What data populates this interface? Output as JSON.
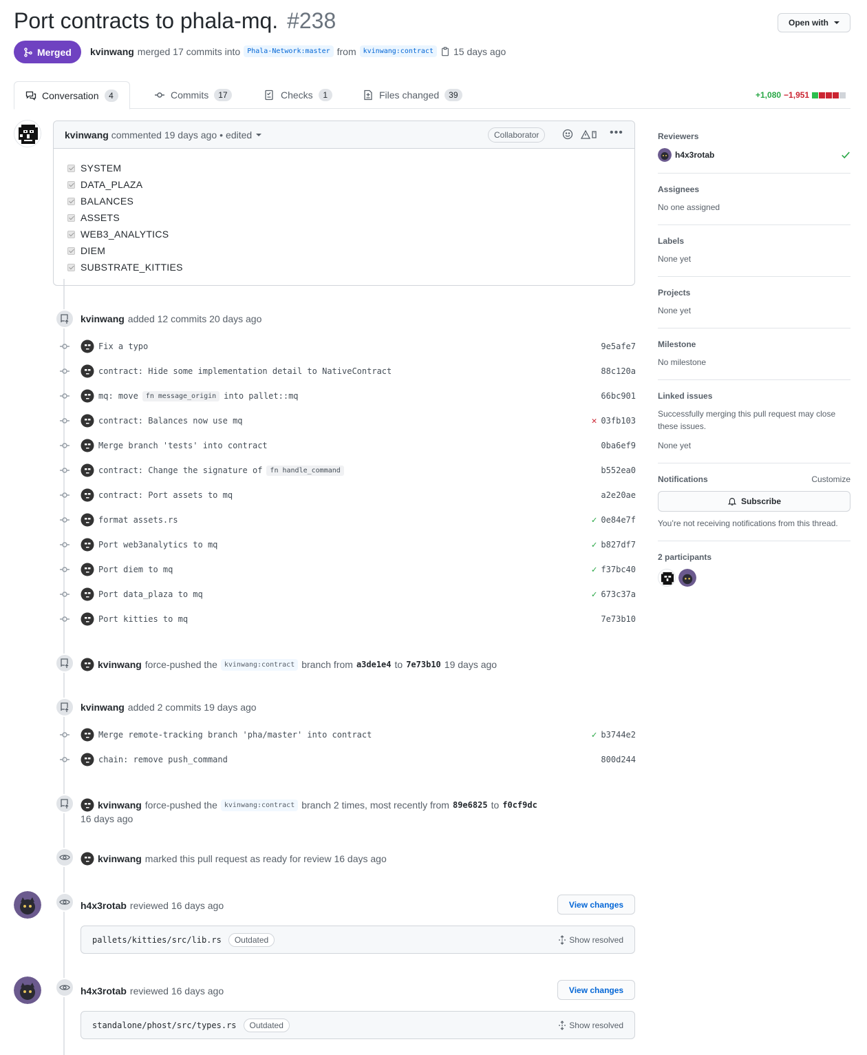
{
  "pr": {
    "title": "Port contracts to phala-mq.",
    "number": "#238",
    "status": "Merged",
    "author": "kvinwang",
    "merged_text": "merged 17 commits into",
    "base_branch": "Phala-Network:master",
    "from_text": "from",
    "head_branch": "kvinwang:contract",
    "time": "15 days ago",
    "open_with": "Open with"
  },
  "tabs": [
    {
      "label": "Conversation",
      "count": "4"
    },
    {
      "label": "Commits",
      "count": "17"
    },
    {
      "label": "Checks",
      "count": "1"
    },
    {
      "label": "Files changed",
      "count": "39"
    }
  ],
  "diffstat": {
    "additions": "+1,080",
    "deletions": "−1,951"
  },
  "comment": {
    "author": "kvinwang",
    "meta": "commented 19 days ago",
    "edited": "edited",
    "role": "Collaborator",
    "items": [
      "SYSTEM",
      "DATA_PLAZA",
      "BALANCES",
      "ASSETS",
      "WEB3_ANALYTICS",
      "DIEM",
      "SUBSTRATE_KITTIES"
    ]
  },
  "event1": {
    "author": "kvinwang",
    "text": "added 12 commits 20 days ago"
  },
  "commits1": [
    {
      "msg": "Fix a typo",
      "sha": "9e5afe7",
      "status": ""
    },
    {
      "msg": "contract: Hide some implementation detail to NativeContract",
      "sha": "88c120a",
      "status": ""
    },
    {
      "msg_pre": "mq: move",
      "code": "fn message_origin",
      "msg_post": "into pallet::mq",
      "sha": "66bc901",
      "status": ""
    },
    {
      "msg": "contract: Balances now use mq",
      "sha": "03fb103",
      "status": "fail"
    },
    {
      "msg": "Merge branch 'tests' into contract",
      "sha": "0ba6ef9",
      "status": ""
    },
    {
      "msg_pre": "contract: Change the signature of",
      "code": "fn handle_command",
      "msg_post": "",
      "sha": "b552ea0",
      "status": ""
    },
    {
      "msg": "contract: Port assets to mq",
      "sha": "a2e20ae",
      "status": ""
    },
    {
      "msg": "format assets.rs",
      "sha": "0e84e7f",
      "status": "ok"
    },
    {
      "msg": "Port web3analytics to mq",
      "sha": "b827df7",
      "status": "ok"
    },
    {
      "msg": "Port diem to mq",
      "sha": "f37bc40",
      "status": "ok"
    },
    {
      "msg": "Port data_plaza to mq",
      "sha": "673c37a",
      "status": "ok"
    },
    {
      "msg": "Port kitties to mq",
      "sha": "7e73b10",
      "status": ""
    }
  ],
  "event2": {
    "author": "kvinwang",
    "pre": "force-pushed the",
    "branch": "kvinwang:contract",
    "mid": "branch from",
    "from": "a3de1e4",
    "to_word": "to",
    "to": "7e73b10",
    "time": "19 days ago"
  },
  "event3": {
    "author": "kvinwang",
    "text": "added 2 commits 19 days ago"
  },
  "commits2": [
    {
      "msg": "Merge remote-tracking branch 'pha/master' into contract",
      "sha": "b3744e2",
      "status": "ok"
    },
    {
      "msg": "chain: remove push_command",
      "sha": "800d244",
      "status": ""
    }
  ],
  "event4": {
    "author": "kvinwang",
    "pre": "force-pushed the",
    "branch": "kvinwang:contract",
    "mid": "branch 2 times, most recently from",
    "from": "89e6825",
    "to_word": "to",
    "to": "f0cf9dc",
    "time": "16 days ago"
  },
  "event5": {
    "author": "kvinwang",
    "text": "marked this pull request as ready for review 16 days ago"
  },
  "reviews": [
    {
      "author": "h4x3rotab",
      "text": "reviewed 16 days ago",
      "button": "View changes",
      "file": "pallets/kitties/src/lib.rs",
      "tag": "Outdated",
      "action": "Show resolved"
    },
    {
      "author": "h4x3rotab",
      "text": "reviewed 16 days ago",
      "button": "View changes",
      "file": "standalone/phost/src/types.rs",
      "tag": "Outdated",
      "action": "Show resolved"
    }
  ],
  "sidebar": {
    "reviewers_h": "Reviewers",
    "reviewer": "h4x3rotab",
    "assignees_h": "Assignees",
    "assignees_v": "No one assigned",
    "labels_h": "Labels",
    "labels_v": "None yet",
    "projects_h": "Projects",
    "projects_v": "None yet",
    "milestone_h": "Milestone",
    "milestone_v": "No milestone",
    "linked_h": "Linked issues",
    "linked_desc": "Successfully merging this pull request may close these issues.",
    "linked_v": "None yet",
    "notif_h": "Notifications",
    "customize": "Customize",
    "subscribe": "Subscribe",
    "notif_v": "You’re not receiving notifications from this thread.",
    "participants_h": "2 participants"
  },
  "colors": {
    "merged": "#6f42c1",
    "add": "#28a745",
    "del": "#cb2431",
    "link": "#0366d6"
  }
}
